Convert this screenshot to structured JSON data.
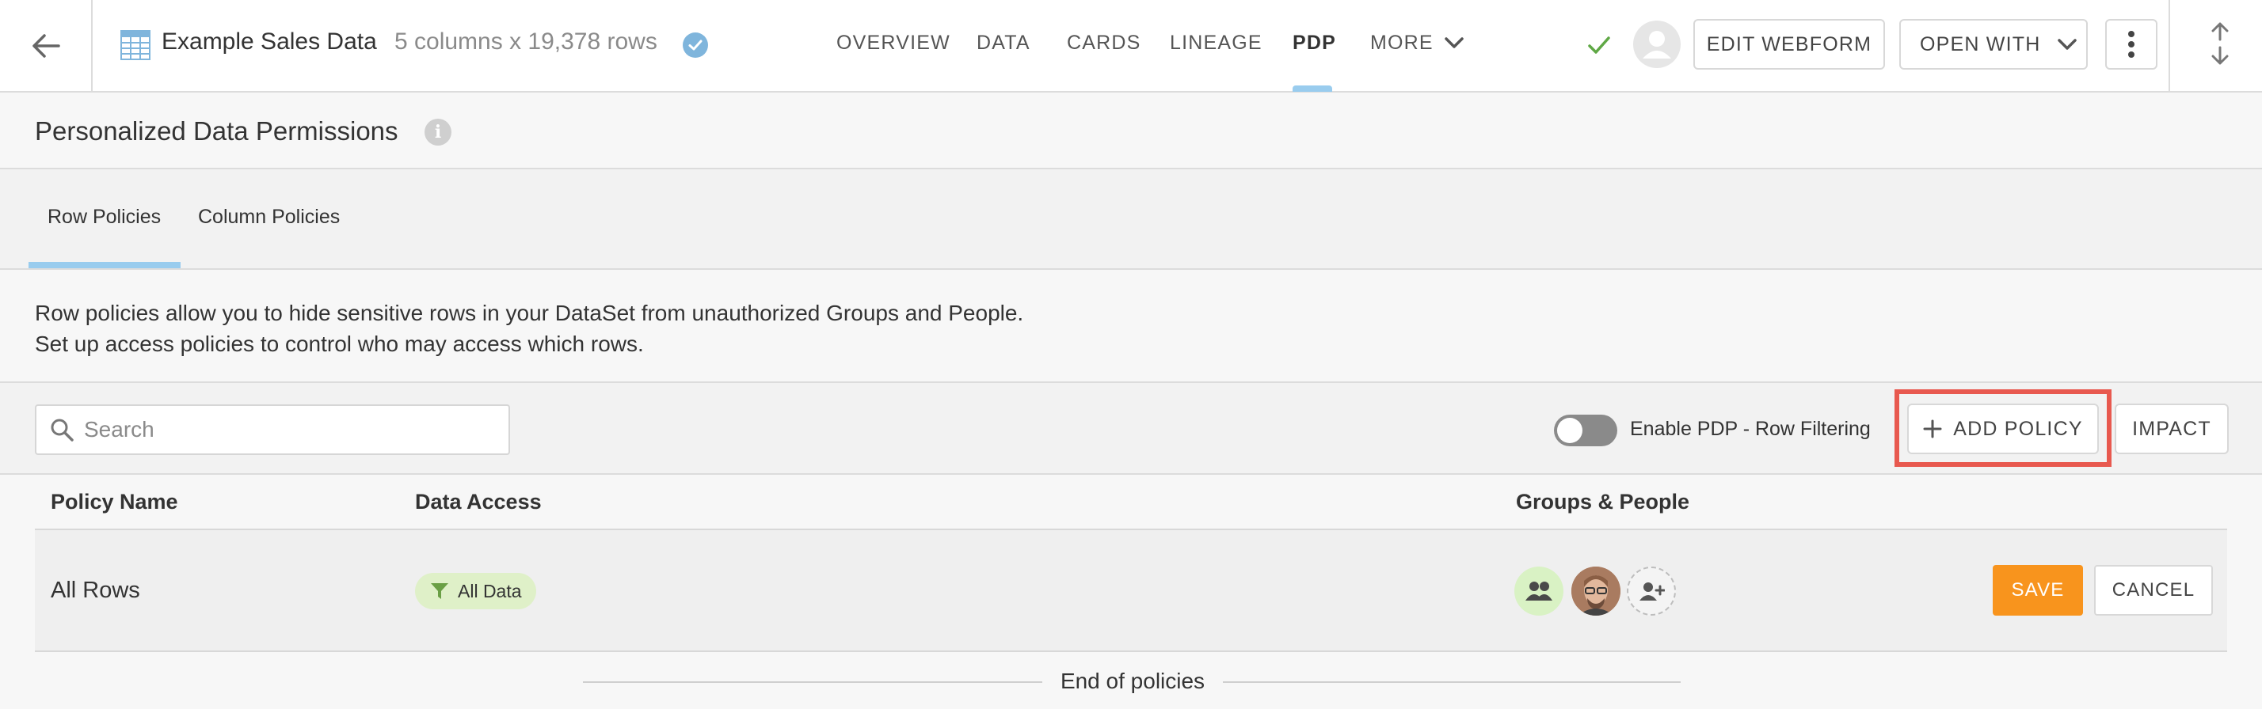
{
  "header": {
    "dataset_icon": "table-grid-icon",
    "dataset_title": "Example Sales Data",
    "dataset_meta": "5 columns x 19,378 rows",
    "certified_icon": "certified-check-icon",
    "tabs": [
      {
        "label": "OVERVIEW",
        "active": false
      },
      {
        "label": "DATA",
        "active": false
      },
      {
        "label": "CARDS",
        "active": false
      },
      {
        "label": "LINEAGE",
        "active": false
      },
      {
        "label": "PDP",
        "active": true
      },
      {
        "label": "MORE",
        "active": false
      }
    ],
    "status_icon": "check-icon",
    "edit_webform_label": "EDIT WEBFORM",
    "open_with_label": "OPEN WITH",
    "accent_color": "#99ccee"
  },
  "section": {
    "title": "Personalized Data Permissions",
    "info_glyph": "i"
  },
  "subtabs": [
    {
      "label": "Row Policies",
      "active": true
    },
    {
      "label": "Column Policies",
      "active": false
    }
  ],
  "description": {
    "line1": "Row policies allow you to hide sensitive rows in your DataSet from unauthorized Groups and People.",
    "line2": "Set up access policies to control who may access which rows."
  },
  "toolbar": {
    "search_placeholder": "Search",
    "search_value": "",
    "toggle_label": "Enable PDP - Row Filtering",
    "toggle_on": false,
    "add_policy_label": "ADD POLICY",
    "impact_label": "IMPACT",
    "highlight_color": "#e8594f"
  },
  "table": {
    "columns": [
      "Policy Name",
      "Data Access",
      "Groups & People"
    ],
    "rows": [
      {
        "name": "All Rows",
        "data_access": "All Data",
        "save_label": "SAVE",
        "cancel_label": "CANCEL"
      }
    ],
    "footer": "End of policies"
  },
  "colors": {
    "save_button": "#f8941d",
    "chip_bg": "#dff0c8",
    "toggle_off": "#8a8a8a"
  }
}
